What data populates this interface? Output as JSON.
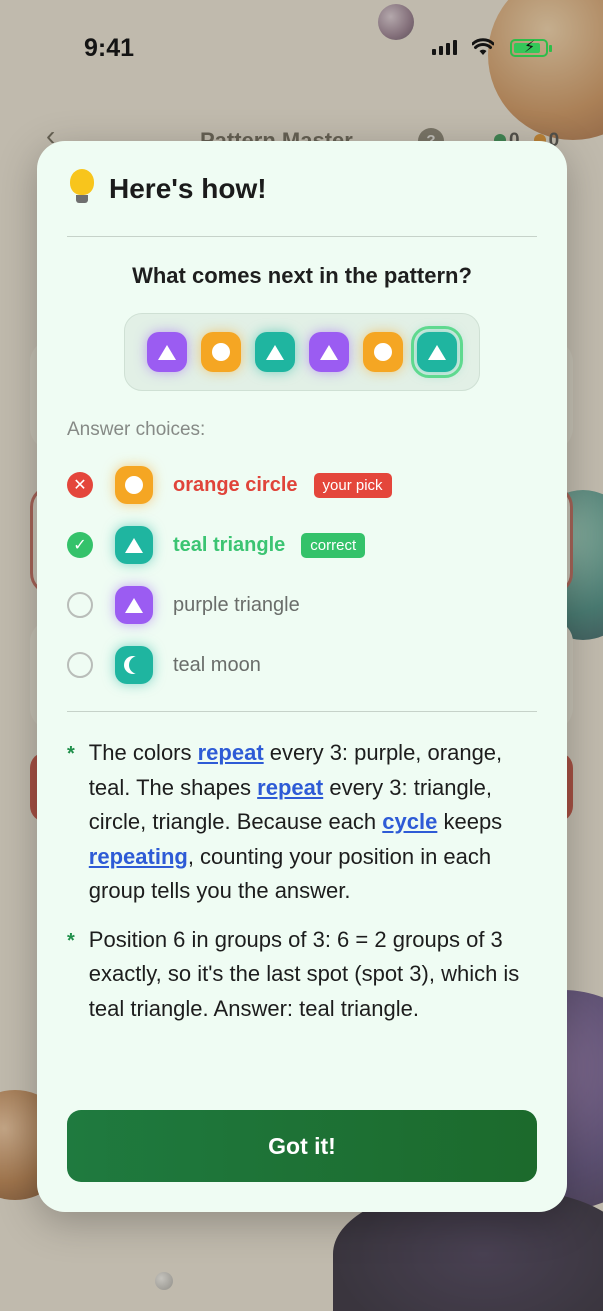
{
  "status_bar": {
    "time": "9:41"
  },
  "background": {
    "title": "Pattern Master",
    "help": "?",
    "gems": "0",
    "coins": "0"
  },
  "modal": {
    "title": "Here's how!",
    "question": "What comes next in the pattern?",
    "choices_label": "Answer choices:",
    "choices": [
      {
        "label": "orange circle",
        "badge": "your pick"
      },
      {
        "label": "teal triangle",
        "badge": "correct"
      },
      {
        "label": "purple triangle"
      },
      {
        "label": "teal moon"
      }
    ],
    "explanation": {
      "p1": {
        "a": "The colors ",
        "k1": "repeat",
        "b": " every 3: purple, orange, teal. The shapes ",
        "k2": "repeat",
        "c": " every 3: triangle, circle, triangle. Because each ",
        "k3": "cycle",
        "d": " keeps ",
        "k4": "repeating",
        "e": ", counting your position in each group tells you the answer."
      },
      "p2": "Position 6 in groups of 3: 6 = 2 groups of 3 exactly, so it's the last spot (spot 3), which is teal triangle. Answer: teal triangle."
    },
    "button_label": "Got it!"
  }
}
